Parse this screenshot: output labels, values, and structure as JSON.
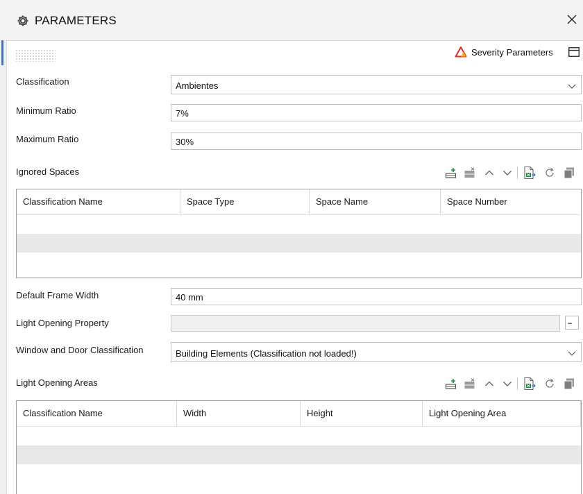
{
  "window": {
    "title": "PARAMETERS",
    "icon": "gear-icon",
    "close_icon": "close-icon"
  },
  "toolbar": {
    "severity_label": "Severity Parameters",
    "severity_icon": "warning-triangle-icon",
    "panel_icon": "panel-toggle-icon"
  },
  "form": {
    "classification": {
      "label": "Classification",
      "value": "Ambientes"
    },
    "minimum_ratio": {
      "label": "Minimum Ratio",
      "value": "7%"
    },
    "maximum_ratio": {
      "label": "Maximum Ratio",
      "value": "30%"
    },
    "default_frame_width": {
      "label": "Default Frame Width",
      "value": "40 mm"
    },
    "light_opening_property": {
      "label": "Light Opening Property",
      "value": "",
      "browse_label": "..."
    },
    "window_door_classification": {
      "label": "Window and Door Classification",
      "value": "Building Elements (Classification not loaded!)"
    }
  },
  "ignored_spaces": {
    "label": "Ignored Spaces",
    "columns": [
      "Classification Name",
      "Space Type",
      "Space Name",
      "Space Number"
    ],
    "rows": []
  },
  "light_opening_areas": {
    "label": "Light Opening Areas",
    "columns": [
      "Classification Name",
      "Width",
      "Height",
      "Light Opening Area"
    ],
    "rows": []
  },
  "grid_toolbar_icons": [
    "add-row-icon",
    "delete-row-icon",
    "move-up-icon",
    "move-down-icon",
    "export-excel-icon",
    "refresh-icon",
    "copy-icon"
  ],
  "colors": {
    "accent": "#3b78c4",
    "title_bar": "#f3f3f3",
    "alt_row": "#e8e8e8",
    "warning_red": "#e32d2d",
    "warning_yellow": "#f7b500",
    "excel_green": "#1e8e3e"
  }
}
